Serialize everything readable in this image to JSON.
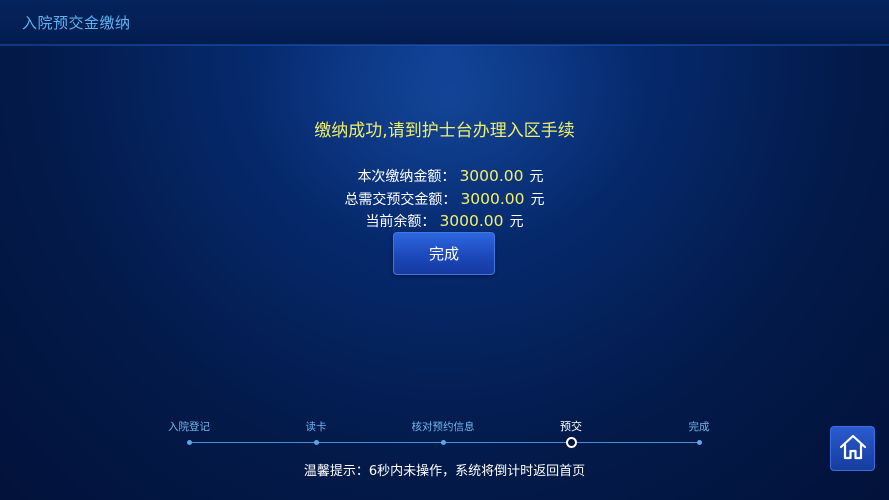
{
  "header": {
    "title": "入院预交金缴纳"
  },
  "result": {
    "message": "缴纳成功,请到护士台办理入区手续",
    "this_payment_label": "本次缴纳金额：",
    "this_payment_value": "3000.00",
    "total_deposit_label": "总需交预交金额：",
    "total_deposit_value": "3000.00",
    "balance_label": "当前余额：",
    "balance_value": "3000.00",
    "currency_unit": "元"
  },
  "actions": {
    "done_label": "完成"
  },
  "steps": [
    {
      "label": "入院登记",
      "active": false
    },
    {
      "label": "读卡",
      "active": false
    },
    {
      "label": "核对预约信息",
      "active": false
    },
    {
      "label": "预交",
      "active": true
    },
    {
      "label": "完成",
      "active": false
    }
  ],
  "footer": {
    "tip": "温馨提示：6秒内未操作，系统将倒计时返回首页"
  },
  "icons": {
    "home": "home-icon"
  },
  "colors": {
    "highlight_yellow": "#f0f06a",
    "header_text": "#5fb4f0",
    "button_blue": "#1b47b8",
    "background": "#031a4a"
  }
}
